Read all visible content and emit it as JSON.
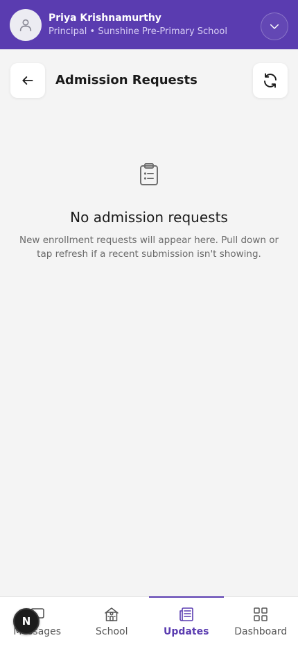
{
  "profile": {
    "name": "Priya Krishnamurthy",
    "role": "Principal • Sunshine Pre-Primary School"
  },
  "page": {
    "title": "Admission Requests"
  },
  "empty_state": {
    "title": "No admission requests",
    "description": "New enrollment requests will appear here. Pull down or tap refresh if a recent submission isn't showing."
  },
  "nav": {
    "items": [
      {
        "label": "Messages",
        "icon": "message-icon",
        "active": false
      },
      {
        "label": "School",
        "icon": "school-icon",
        "active": false
      },
      {
        "label": "Updates",
        "icon": "newspaper-icon",
        "active": true
      },
      {
        "label": "Dashboard",
        "icon": "grid-icon",
        "active": false
      }
    ]
  },
  "floating_badge": {
    "letter": "N"
  },
  "colors": {
    "brand": "#5a3cb0",
    "background": "#f4f4f4"
  }
}
